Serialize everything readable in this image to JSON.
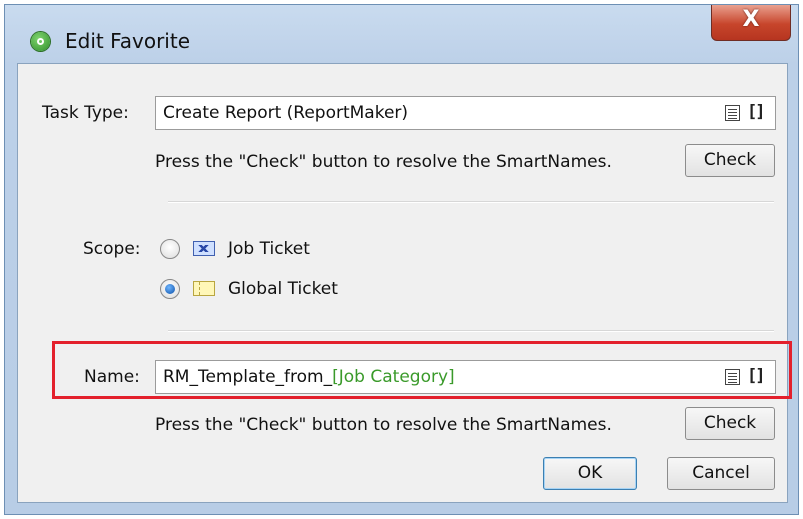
{
  "window": {
    "title": "Edit Favorite",
    "close_label": "X"
  },
  "task_type": {
    "label": "Task Type:",
    "value": "Create Report (ReportMaker)",
    "hint": "Press the \"Check\" button to resolve the SmartNames.",
    "check_label": "Check"
  },
  "scope": {
    "label": "Scope:",
    "options": [
      {
        "label": "Job Ticket",
        "checked": false,
        "icon": "job-ticket-icon"
      },
      {
        "label": "Global Ticket",
        "checked": true,
        "icon": "global-ticket-icon"
      }
    ]
  },
  "name": {
    "label": "Name:",
    "value_plain": "RM_Template_from_",
    "value_smartname": "[Job Category]",
    "hint": "Press the \"Check\" button to resolve the SmartNames.",
    "check_label": "Check"
  },
  "buttons": {
    "ok": "OK",
    "cancel": "Cancel"
  },
  "colors": {
    "smartname": "#3a9a2a",
    "highlight": "#e3202c",
    "close_button": "#c7452b"
  }
}
